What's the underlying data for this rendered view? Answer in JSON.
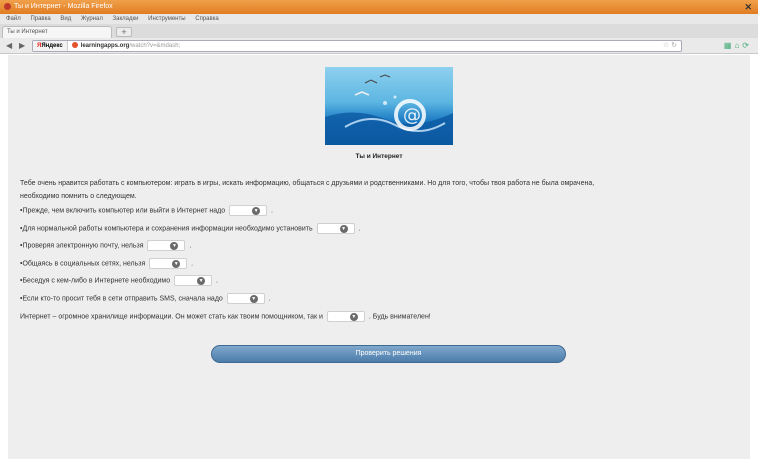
{
  "browser": {
    "window_title": "Ты и Интернет - Mozilla Firefox",
    "menu": [
      "Файл",
      "Правка",
      "Вид",
      "Журнал",
      "Закладки",
      "Инструменты",
      "Справка"
    ],
    "tab_label": "Ты и Интернет",
    "new_tab": "+",
    "yandex_label": "Яндекс",
    "url_host": "learningapps.org",
    "url_path": "/watch?v=&mdash;"
  },
  "page": {
    "subtitle": "Ты и Интернет",
    "intro_line1": "Тебе очень нравится работать с компьютером: играть в игры, искать информацию, общаться с друзьями и родственниками. Но для того, чтобы твоя работа не была омрачена,",
    "intro_line2": "необходимо помнить о следующем.",
    "items": [
      {
        "before": "•Прежде, чем включить компьютер или выйти в Интернет надо",
        "after": "."
      },
      {
        "before": "•Для нормальной работы компьютера и сохранения информации необходимо установить",
        "after": "."
      },
      {
        "before": "•Проверяя электронную почту, нельзя",
        "after": "."
      },
      {
        "before": "•Общаясь в социальных сетях, нельзя",
        "after": "."
      },
      {
        "before": "•Беседуя с кем-либо в Интернете необходимо",
        "after": "."
      },
      {
        "before": "•Если кто-то просит тебя в сети отправить SMS, сначала надо",
        "after": "."
      }
    ],
    "final_before": "Интернет – огромное хранилище информации. Он может стать как твоим помощником, так и",
    "final_after": ". Будь внимателен!",
    "check_button": "Проверить решения"
  }
}
